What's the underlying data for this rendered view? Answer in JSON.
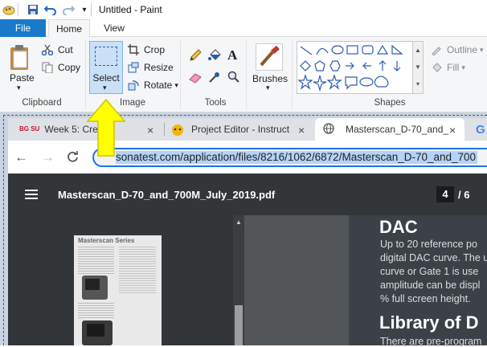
{
  "window": {
    "title": "Untitled - Paint"
  },
  "ribbon": {
    "tabs": {
      "file": "File",
      "home": "Home",
      "view": "View"
    },
    "clipboard": {
      "paste": "Paste",
      "cut": "Cut",
      "copy": "Copy",
      "label": "Clipboard"
    },
    "image": {
      "select": "Select",
      "crop": "Crop",
      "resize": "Resize",
      "rotate": "Rotate",
      "label": "Image"
    },
    "tools": {
      "label": "Tools"
    },
    "brushes": {
      "label": "Brushes"
    },
    "shapes": {
      "label": "Shapes",
      "outline": "Outline",
      "fill": "Fill"
    }
  },
  "browser": {
    "tabs": [
      {
        "label": "Week 5: Cre",
        "favicon": "BG SU"
      },
      {
        "label": "Project Editor - Instruct"
      },
      {
        "label": "Masterscan_D-70_and_"
      }
    ],
    "url": "sonatest.com/application/files/8216/1062/6872/Masterscan_D-70_and_700",
    "pdf": {
      "filename": "Masterscan_D-70_and_700M_July_2019.pdf",
      "page_current": "4",
      "page_total": "/ 6",
      "thumb_title": "Masterscan Series",
      "heading1": "DAC",
      "body_lines": [
        "Up to 20 reference po",
        "digital DAC curve. The u",
        "curve or Gate 1 is use",
        "amplitude can be displ",
        "% full screen height."
      ],
      "heading2": "Library of D",
      "body2": "There are pre-program"
    }
  },
  "colors": {
    "accent": "#1979ca",
    "arrow": "#ffff00",
    "pdf_toolbar": "#323639"
  }
}
